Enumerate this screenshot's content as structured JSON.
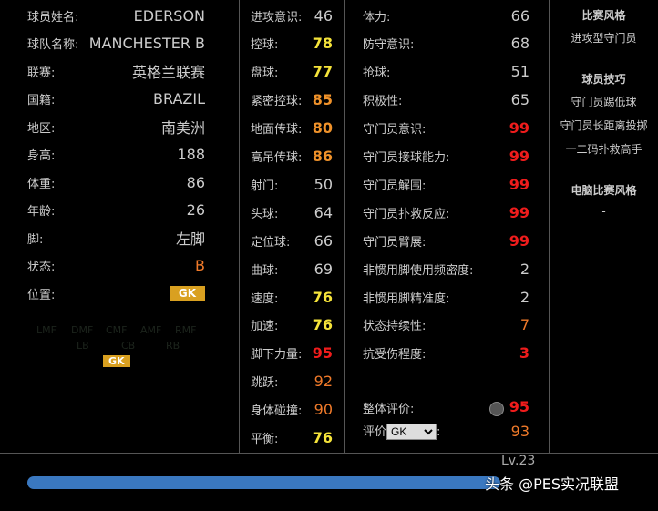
{
  "info": [
    {
      "label": "球员姓名:",
      "value": "EDERSON"
    },
    {
      "label": "球队名称:",
      "value": "MANCHESTER B"
    },
    {
      "label": "联赛:",
      "value": "英格兰联赛"
    },
    {
      "label": "国籍:",
      "value": "BRAZIL"
    },
    {
      "label": "地区:",
      "value": "南美洲"
    },
    {
      "label": "身高:",
      "value": "188"
    },
    {
      "label": "体重:",
      "value": "86"
    },
    {
      "label": "年龄:",
      "value": "26"
    },
    {
      "label": "脚:",
      "value": "左脚"
    },
    {
      "label": "状态:",
      "value": "B"
    },
    {
      "label": "位置:",
      "value": "GK"
    }
  ],
  "positions": {
    "row1": [
      "LMF",
      "DMF",
      "CMF",
      "AMF",
      "RMF"
    ],
    "row2": [
      "LB",
      "CB",
      "RB"
    ],
    "active": "GK"
  },
  "stats1": [
    {
      "label": "进攻意识:",
      "value": "46",
      "c": "w"
    },
    {
      "label": "控球:",
      "value": "78",
      "c": "y"
    },
    {
      "label": "盘球:",
      "value": "77",
      "c": "y"
    },
    {
      "label": "紧密控球:",
      "value": "85",
      "c": "o"
    },
    {
      "label": "地面传球:",
      "value": "80",
      "c": "o"
    },
    {
      "label": "高吊传球:",
      "value": "86",
      "c": "o"
    },
    {
      "label": "射门:",
      "value": "50",
      "c": "w"
    },
    {
      "label": "头球:",
      "value": "64",
      "c": "w"
    },
    {
      "label": "定位球:",
      "value": "66",
      "c": "w"
    },
    {
      "label": "曲球:",
      "value": "69",
      "c": "w"
    },
    {
      "label": "速度:",
      "value": "76",
      "c": "y"
    },
    {
      "label": "加速:",
      "value": "76",
      "c": "y"
    },
    {
      "label": "脚下力量:",
      "value": "95",
      "c": "r"
    },
    {
      "label": "跳跃:",
      "value": "92",
      "c": "o2"
    },
    {
      "label": "身体碰撞:",
      "value": "90",
      "c": "o2"
    },
    {
      "label": "平衡:",
      "value": "76",
      "c": "y"
    }
  ],
  "stats2": [
    {
      "label": "体力:",
      "value": "66",
      "c": "w"
    },
    {
      "label": "防守意识:",
      "value": "68",
      "c": "w"
    },
    {
      "label": "抢球:",
      "value": "51",
      "c": "w"
    },
    {
      "label": "积极性:",
      "value": "65",
      "c": "w"
    },
    {
      "label": "守门员意识:",
      "value": "99",
      "c": "r"
    },
    {
      "label": "守门员接球能力:",
      "value": "99",
      "c": "r"
    },
    {
      "label": "守门员解围:",
      "value": "99",
      "c": "r"
    },
    {
      "label": "守门员扑救反应:",
      "value": "99",
      "c": "r"
    },
    {
      "label": "守门员臂展:",
      "value": "99",
      "c": "r"
    },
    {
      "label": "非惯用脚使用频密度:",
      "value": "2",
      "c": "w"
    },
    {
      "label": "非惯用脚精准度:",
      "value": "2",
      "c": "w"
    },
    {
      "label": "状态持续性:",
      "value": "7",
      "c": "o2"
    },
    {
      "label": "抗受伤程度:",
      "value": "3",
      "c": "r"
    }
  ],
  "overall": {
    "label": "整体评价:",
    "value": "95"
  },
  "rating": {
    "label": "评价",
    "selected": "GK",
    "colon": ":",
    "value": "93"
  },
  "side": {
    "style_title": "比赛风格",
    "style": "进攻型守门员",
    "skills_title": "球员技巧",
    "skills": [
      "守门员踢低球",
      "守门员长距离投掷",
      "十二码扑救高手"
    ],
    "com_title": "电脑比赛风格",
    "com": "-"
  },
  "level": {
    "label": "Lv.23",
    "progress": 0.97
  },
  "watermark": "头条 @PES实况联盟"
}
